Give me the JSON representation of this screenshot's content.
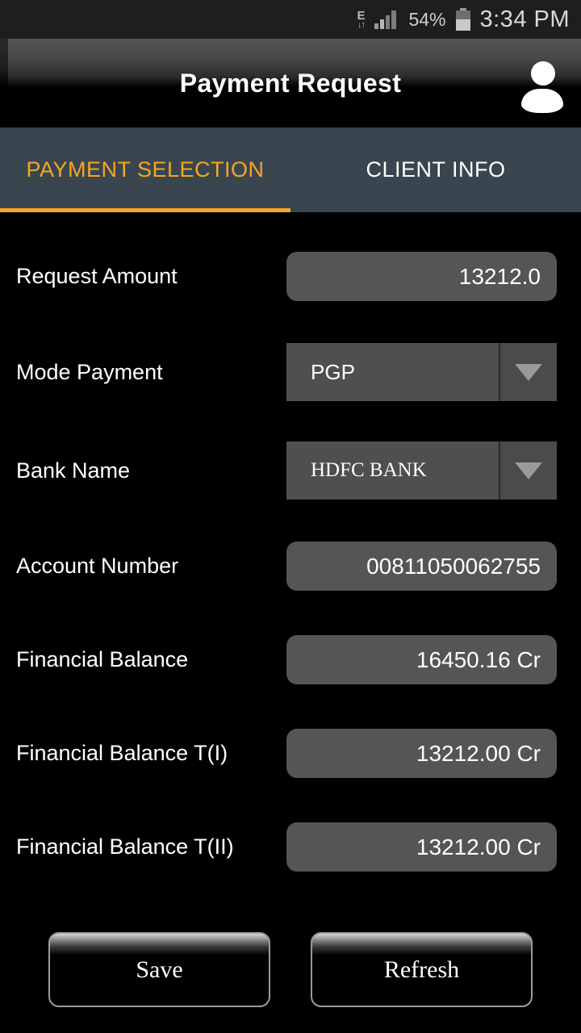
{
  "status_bar": {
    "network_type": "E",
    "network_arrows": "↓↑",
    "battery_percent": "54%",
    "time": "3:34 PM",
    "icons": {
      "network": "edge-network-icon",
      "signal": "signal-bars-icon",
      "battery": "battery-icon"
    }
  },
  "title_bar": {
    "title": "Payment Request",
    "avatar_icon": "user-avatar-icon"
  },
  "tabs": [
    {
      "label": "PAYMENT SELECTION",
      "active": true
    },
    {
      "label": "CLIENT INFO",
      "active": false
    }
  ],
  "form": {
    "fields": [
      {
        "label": "Request Amount",
        "type": "text",
        "value": "13212.0",
        "name": "request-amount"
      },
      {
        "label": "Mode Payment",
        "type": "spinner",
        "value": "PGP",
        "name": "mode-payment"
      },
      {
        "label": "Bank Name",
        "type": "spinner",
        "value": "HDFC BANK",
        "name": "bank-name"
      },
      {
        "label": "Account Number",
        "type": "text",
        "value": "00811050062755",
        "name": "account-number"
      },
      {
        "label": "Financial Balance",
        "type": "text",
        "value": "16450.16 Cr",
        "name": "financial-balance"
      },
      {
        "label": "Financial Balance T(I)",
        "type": "text",
        "value": "13212.00 Cr",
        "name": "financial-balance-t1"
      },
      {
        "label": "Financial Balance T(II)",
        "type": "text",
        "value": "13212.00 Cr",
        "name": "financial-balance-t2"
      }
    ]
  },
  "actions": {
    "save_label": "Save",
    "refresh_label": "Refresh"
  },
  "colors": {
    "accent_orange": "#f5a623",
    "tabbar_background": "#39464f",
    "field_background": "#555555",
    "spinner_background": "#4f4f4f",
    "page_background": "#000000",
    "status_bar_background": "#1e1e1e"
  }
}
